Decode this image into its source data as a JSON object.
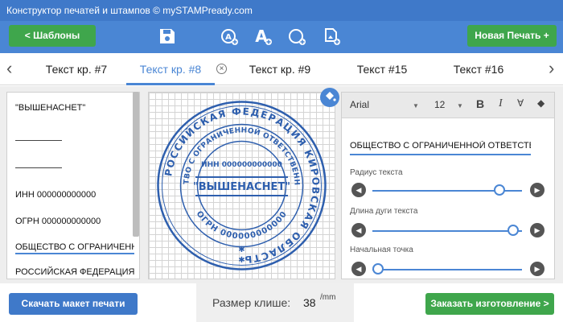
{
  "window": {
    "title": "Конструктор печатей и штампов © mySTAMPready.com"
  },
  "toolbar": {
    "templates_label": "< Шаблоны",
    "new_stamp_label": "Новая Печать +",
    "icons": [
      "save-icon",
      "add-circle-text-icon",
      "add-text-icon",
      "add-circle-icon",
      "add-image-icon"
    ]
  },
  "tabs": {
    "items": [
      {
        "label": "Текст кр. #7"
      },
      {
        "label": "Текст кр. #8"
      },
      {
        "label": "Текст кр. #9"
      },
      {
        "label": "Текст #15"
      },
      {
        "label": "Текст #16"
      }
    ],
    "active_index": 1,
    "close_glyph": "×"
  },
  "lines": [
    "\"ВЫШЕНАСНЕТ\"",
    "",
    "",
    "ИНН 000000000000",
    "ОГРН 000000000000",
    "ОБЩЕСТВО С ОГРАНИЧЕННОЙ ОТВЕТСТВЕННОСТЬЮ",
    "РОССИЙСКАЯ ФЕДЕРАЦИЯ КИРОВСКАЯ ОБЛАСТЬ"
  ],
  "stamp": {
    "center_text": "\"ВЫШЕНАСНЕТ\"",
    "outer_ring_text": "РОССИЙСКАЯ ФЕДЕРАЦИЯ КИРОВСКАЯ ОБЛАСТЬ",
    "inner_ring_top_text": "ОБЩЕСТВО С ОГРАНИЧЕННОЙ ОТВЕТСТВЕННОСТЬЮ",
    "inner_ring_bottom_text": "ОГРН 000000000000",
    "inn_text": "ИНН 000000000000",
    "ink_color": "#2e5fae"
  },
  "properties": {
    "font": "Arial",
    "font_size": "12",
    "text_value": "ОБЩЕСТВО С ОГРАНИЧЕННОЙ ОТВЕТСТВЕННОСТЬЮ",
    "sliders": [
      {
        "label": "Радиус текста",
        "value": 0.86
      },
      {
        "label": "Длина дуги текста",
        "value": 0.95
      },
      {
        "label": "Начальная точка",
        "value": 0.05
      }
    ]
  },
  "bottom": {
    "download_label": "Скачать макет печати",
    "size_label": "Размер клише:",
    "size_value": "38",
    "size_unit": "/mm",
    "order_label": "Заказать изготовление >"
  },
  "colors": {
    "accent": "#4a86d4",
    "green": "#3fa64c",
    "title_blue": "#3f79c9"
  }
}
